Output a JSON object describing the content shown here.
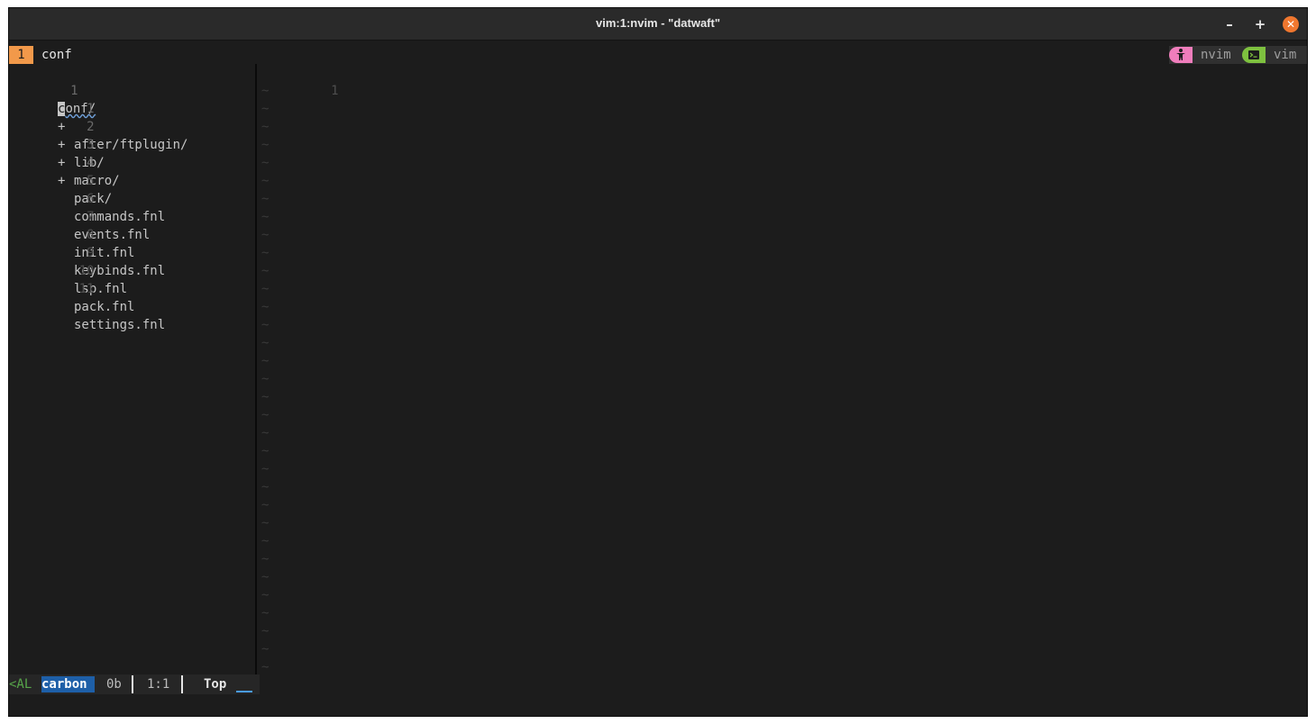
{
  "window": {
    "title": "vim:1:nvim - \"datwaft\"",
    "minimize_label": "–",
    "maximize_label": "+",
    "close_label": "✕"
  },
  "tabline": {
    "tab_number": "1",
    "tab_name": "conf",
    "pills": [
      {
        "name": "nvim",
        "icon": "accessibility-icon",
        "color": "#f07dbc"
      },
      {
        "name": "vim",
        "icon": "terminal-icon",
        "color": "#7ec13f"
      }
    ]
  },
  "tree": {
    "current_line_number": "1",
    "root": {
      "first_char": "c",
      "rest": "onf/"
    },
    "entries": [
      {
        "num": "1",
        "marker": "+",
        "name": "after/ftplugin/"
      },
      {
        "num": "2",
        "marker": "+",
        "name": "lib/"
      },
      {
        "num": "3",
        "marker": "+",
        "name": "macro/"
      },
      {
        "num": "4",
        "marker": "+",
        "name": "pack/"
      },
      {
        "num": "5",
        "marker": "",
        "name": "commands.fnl"
      },
      {
        "num": "6",
        "marker": "",
        "name": "events.fnl"
      },
      {
        "num": "7",
        "marker": "",
        "name": "init.fnl"
      },
      {
        "num": "8",
        "marker": "",
        "name": "keybinds.fnl"
      },
      {
        "num": "9",
        "marker": "",
        "name": "lsp.fnl"
      },
      {
        "num": "10",
        "marker": "",
        "name": "pack.fnl"
      },
      {
        "num": "11",
        "marker": "",
        "name": "settings.fnl"
      }
    ]
  },
  "editor": {
    "line_number": "1",
    "tilde": "~"
  },
  "statusline": {
    "mode": "<AL",
    "filename": "carbon",
    "size": "0b",
    "position": "1:1",
    "scroll": "Top"
  },
  "colors": {
    "accent_orange": "#f2994a",
    "status_blue": "#1e5fa8",
    "close_button": "#f0772f"
  }
}
